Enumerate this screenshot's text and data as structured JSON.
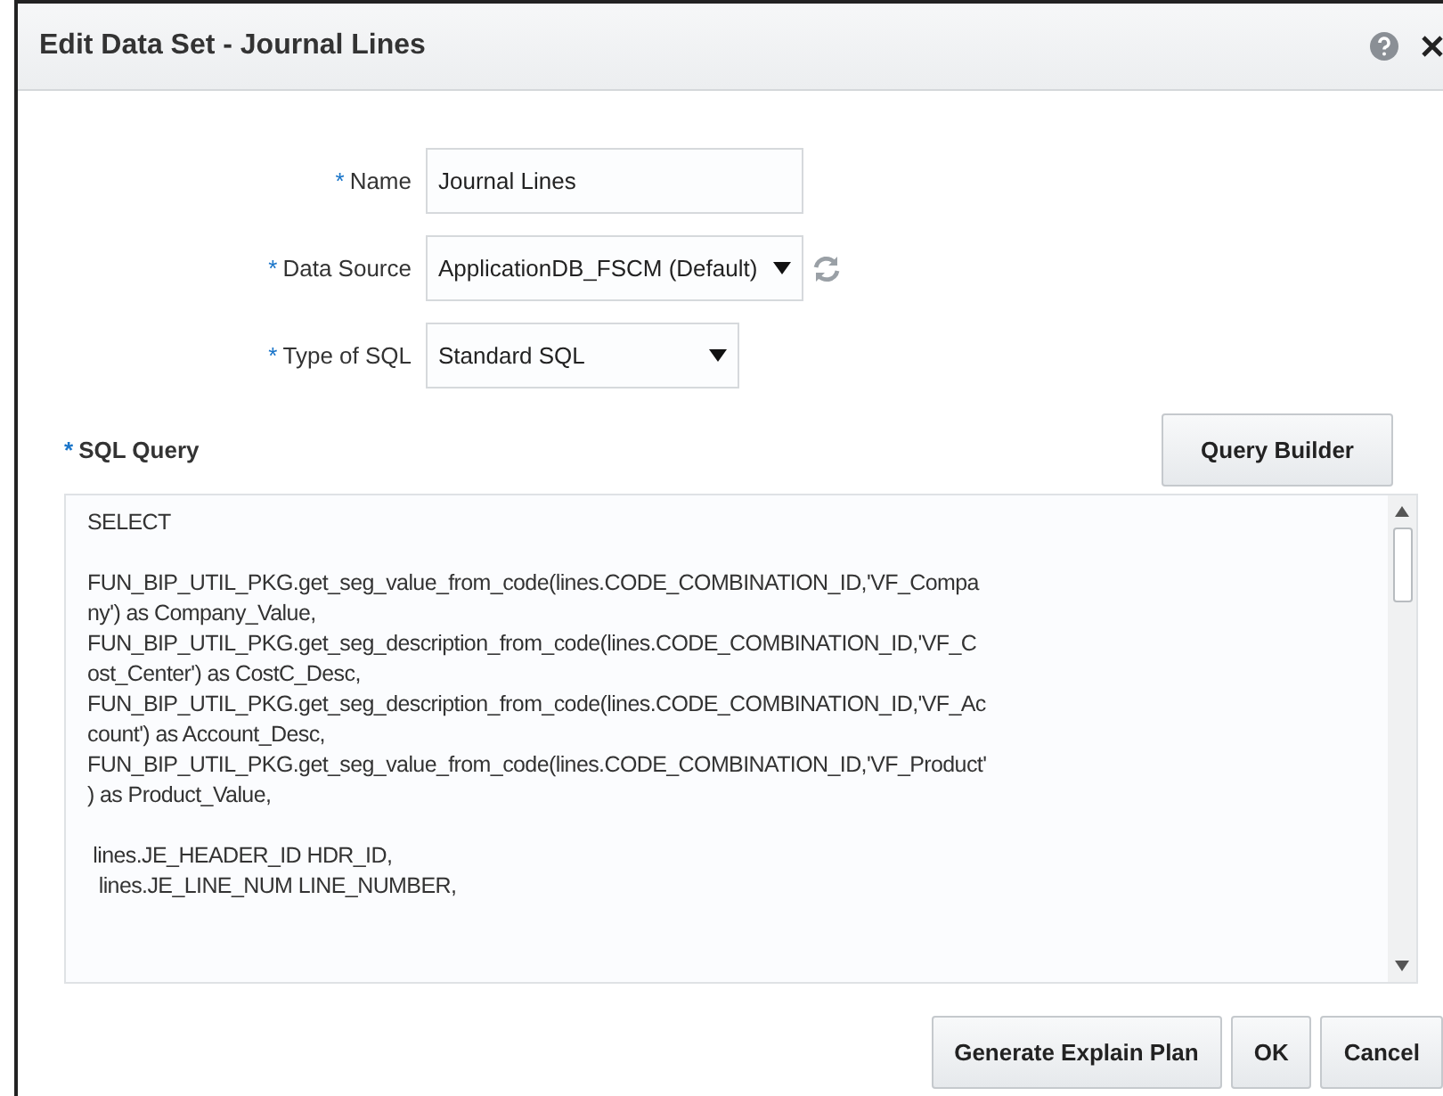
{
  "window": {
    "title": "Edit Data Set - Journal Lines"
  },
  "fields": [
    {
      "label": "Name",
      "required_mark": "*",
      "kind": "text",
      "value": "Journal Lines"
    },
    {
      "label": "Data Source",
      "required_mark": "*",
      "kind": "select",
      "value": "ApplicationDB_FSCM (Default)",
      "refresh": true
    },
    {
      "label": "Type of SQL",
      "required_mark": "*",
      "kind": "select",
      "value": "Standard SQL"
    }
  ],
  "sql": {
    "label": "SQL Query",
    "required_mark": "*",
    "builder_button": "Query Builder",
    "paragraphs": [
      [
        "SELECT"
      ],
      [
        "FUN_BIP_UTIL_PKG.get_seg_value_from_code(lines.CODE_COMBINATION_ID,'VF_Compa",
        "ny') as Company_Value,",
        "FUN_BIP_UTIL_PKG.get_seg_description_from_code(lines.CODE_COMBINATION_ID,'VF_C",
        "ost_Center') as CostC_Desc,",
        "FUN_BIP_UTIL_PKG.get_seg_description_from_code(lines.CODE_COMBINATION_ID,'VF_Ac",
        "count') as Account_Desc,",
        "FUN_BIP_UTIL_PKG.get_seg_value_from_code(lines.CODE_COMBINATION_ID,'VF_Product'",
        ") as Product_Value,"
      ],
      [
        " lines.JE_HEADER_ID HDR_ID,",
        "  lines.JE_LINE_NUM LINE_NUMBER,"
      ]
    ]
  },
  "buttons": [
    "Generate Explain Plan",
    "OK",
    "Cancel"
  ]
}
